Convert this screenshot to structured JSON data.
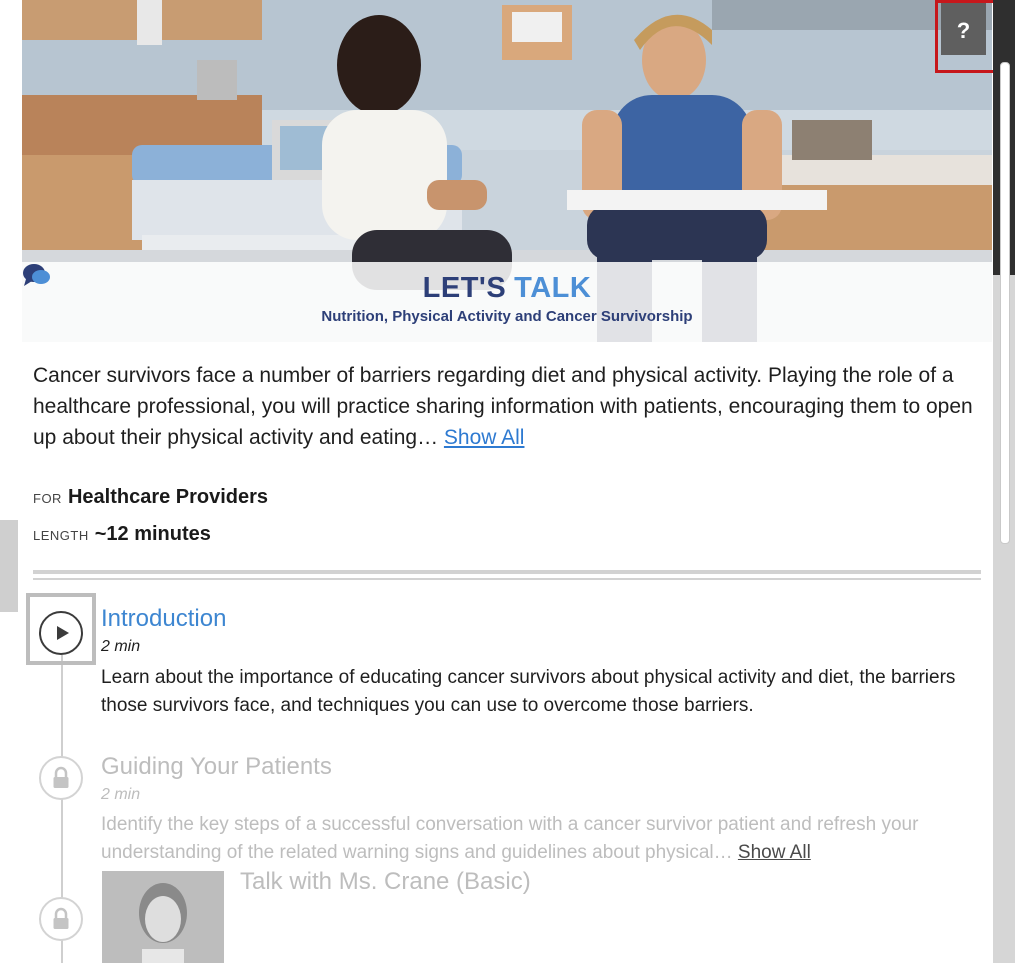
{
  "hero": {
    "logo_word1": "LET'S",
    "logo_word2": "TALK",
    "subtitle": "Nutrition, Physical Activity and Cancer Survivorship"
  },
  "help_button": {
    "label": "?"
  },
  "description": {
    "text": "Cancer survivors face a number of barriers regarding diet and physical activity. Playing the role of a healthcare professional, you will practice sharing information with patients, encouraging them to open up about their physical activity and eating…",
    "show_all": "Show All"
  },
  "meta": {
    "for_label": "FOR",
    "for_value": "Healthcare Providers",
    "length_label": "LENGTH",
    "length_value": "~12 minutes"
  },
  "modules": [
    {
      "title": "Introduction",
      "duration": "2 min",
      "description": "Learn about the importance of educating cancer survivors about physical activity and diet, the barriers those survivors face, and techniques you can use to overcome those barriers.",
      "status": "play",
      "icon": "play-icon"
    },
    {
      "title": "Guiding Your Patients",
      "duration": "2 min",
      "description": "Identify the key steps of a successful conversation with a cancer survivor patient and refresh your understanding of the related warning signs and guidelines about physical…",
      "show_all": "Show All",
      "status": "locked",
      "icon": "lock-icon"
    },
    {
      "title": "Talk with Ms. Crane (Basic)",
      "status": "locked",
      "icon": "lock-icon"
    }
  ],
  "colors": {
    "accent": "#3d86d1",
    "logo_dark": "#2d3f78",
    "help_highlight": "#c6171b"
  }
}
